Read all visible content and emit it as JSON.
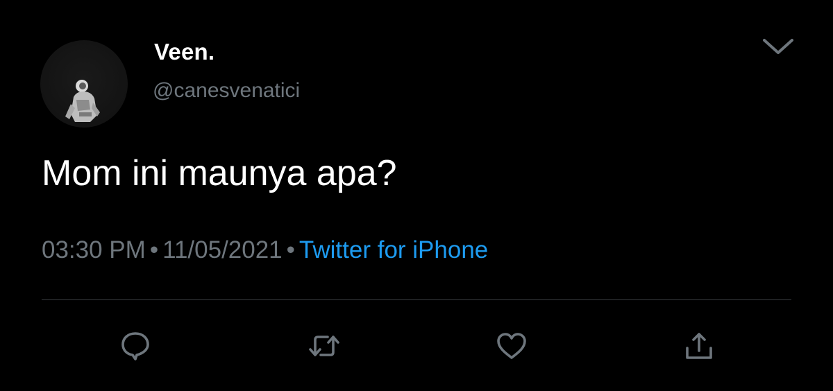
{
  "author": {
    "display_name": "Veen.",
    "handle": "@canesvenatici",
    "avatar_icon": "astronaut-avatar"
  },
  "tweet": {
    "text": "Mom ini maunya apa?",
    "time": "03:30 PM",
    "date": "11/05/2021",
    "separator": "•",
    "source": "Twitter for iPhone"
  },
  "icons": {
    "more": "chevron-down-icon",
    "reply": "reply-icon",
    "retweet": "retweet-icon",
    "like": "heart-icon",
    "share": "share-icon"
  },
  "colors": {
    "background": "#000000",
    "text": "#ffffff",
    "secondary": "#6e767d",
    "link": "#1d9bf0",
    "divider": "#3a3d41"
  }
}
